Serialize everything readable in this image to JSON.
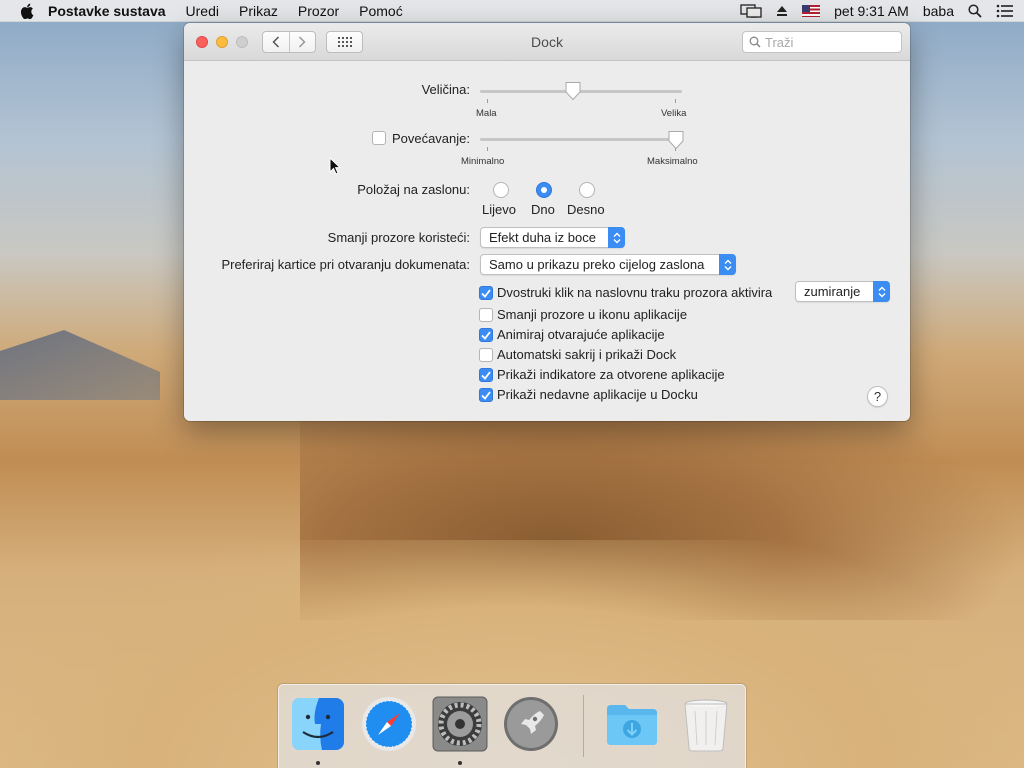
{
  "menubar": {
    "app": "Postavke sustava",
    "items": [
      "Uredi",
      "Prikaz",
      "Prozor",
      "Pomoć"
    ],
    "clock": "pet 9:31 AM",
    "user": "baba"
  },
  "window": {
    "title": "Dock",
    "search_placeholder": "Traži"
  },
  "size": {
    "label": "Veličina:",
    "min_label": "Mala",
    "max_label": "Velika",
    "value": 0.46
  },
  "magnification": {
    "label": "Povećavanje:",
    "checked": false,
    "min_label": "Minimalno",
    "max_label": "Maksimalno",
    "value": 0.97
  },
  "position": {
    "label": "Položaj na zaslonu:",
    "options": [
      "Lijevo",
      "Dno",
      "Desno"
    ],
    "selected": "Dno"
  },
  "minimize_effect": {
    "label": "Smanji prozore koristeći:",
    "value": "Efekt duha iz boce"
  },
  "prefer_tabs": {
    "label": "Preferiraj kartice pri otvaranju dokumenata:",
    "value": "Samo u prikazu preko cijelog zaslona"
  },
  "options": [
    {
      "label": "Dvostruki klik na naslovnu traku prozora aktivira",
      "checked": true
    },
    {
      "label": "Smanji prozore u ikonu aplikacije",
      "checked": false
    },
    {
      "label": "Animiraj otvarajuće aplikacije",
      "checked": true
    },
    {
      "label": "Automatski sakrij i prikaži Dock",
      "checked": false
    },
    {
      "label": "Prikaži indikatore za otvorene aplikacije",
      "checked": true
    },
    {
      "label": "Prikaži nedavne aplikacije u Docku",
      "checked": true
    }
  ],
  "double_click_action": "zumiranje",
  "help_label": "?",
  "colors": {
    "accent": "#3b8cf3",
    "close": "#fc605c",
    "minimize": "#fdbc40"
  }
}
